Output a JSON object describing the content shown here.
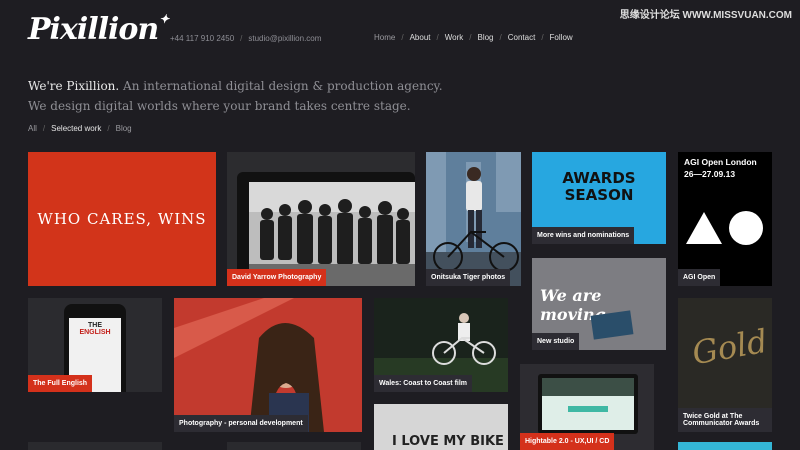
{
  "watermark": "思缘设计论坛 WWW.MISSVUAN.COM",
  "logo": "Pixillion",
  "contact": {
    "phone": "+44 117 910 2450",
    "email": "studio@pixillion.com"
  },
  "nav": [
    {
      "label": "Home"
    },
    {
      "label": "About"
    },
    {
      "label": "Work"
    },
    {
      "label": "Blog"
    },
    {
      "label": "Contact"
    },
    {
      "label": "Follow"
    }
  ],
  "intro": {
    "lead": "We're Pixillion.",
    "line1": "An international digital design & production agency.",
    "line2": "We design digital worlds where your brand takes centre stage."
  },
  "filters": [
    {
      "label": "All"
    },
    {
      "label": "Selected work"
    },
    {
      "label": "Blog"
    }
  ],
  "tiles": {
    "who_cares": "WHO CARES, WINS",
    "yarrow": "David Yarrow Photography",
    "onitsuka": "Onitsuka Tiger photos",
    "awards_art_1": "AWARDS",
    "awards_art_2": "SEASON",
    "awards": "More wins and nominations",
    "agi_title": "AGI Open London",
    "agi_dates": "26—27.09.13",
    "agi": "AGI Open",
    "full_english": "The Full English",
    "english_art_1": "THE",
    "english_art_2": "ENGLISH",
    "portrait": "Photography - personal development",
    "wales": "Wales: Coast to Coast film",
    "moving_art": "We are moving",
    "studio": "New studio",
    "gold_art": "Gold",
    "gold_line1": "Twice Gold at The",
    "gold_line2": "Communicator Awards",
    "hightable": "Hightable 2.0 - UX,UI / CD",
    "bike_art": "I LOVE MY BIKE"
  },
  "colors": {
    "background": "#1e1d22",
    "accent_red": "#d4311b",
    "awards_blue": "#27a7e0",
    "caption_dark": "#2d2c33"
  }
}
